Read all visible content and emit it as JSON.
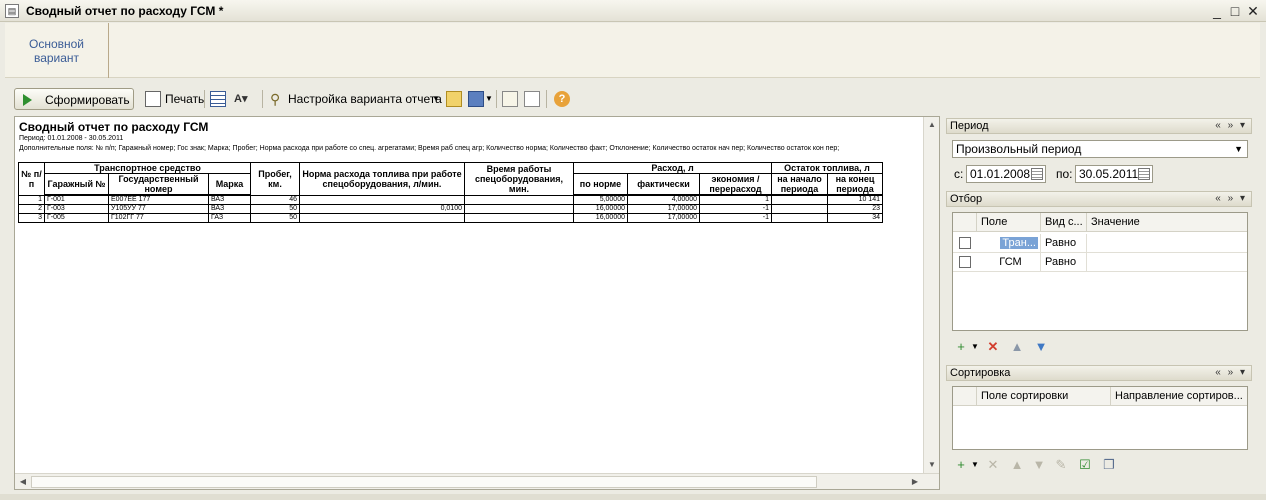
{
  "window": {
    "title": "Сводный отчет по расходу ГСМ *",
    "controls": [
      "_",
      "□",
      "✕"
    ]
  },
  "variant": {
    "label": "Основной вариант"
  },
  "toolbar": {
    "generate": "Сформировать",
    "print": "Печать",
    "settings": "Настройка варианта отчета"
  },
  "report": {
    "title": "Сводный отчет по расходу ГСМ",
    "period": "Период: 01.01.2008 - 30.05.2011",
    "extra": "Дополнительные поля: № п/п; Гаражный номер; Гос знак; Марка; Пробег; Норма расхода при работе со спец. агрегатами; Время раб спец агр; Количество норма; Количество факт; Отклонение; Количество остаток нач пер; Количество остаток кон пер;",
    "headers": {
      "num": "№ п/п",
      "transport": "Транспортное средство",
      "garage": "Гаражный №",
      "plate": "Государственный номер",
      "brand": "Марка",
      "mileage": "Пробег, км.",
      "norm": "Норма расхода топлива при работе спецоборудования, л/мин.",
      "worktime": "Время работы спецоборудования, мин.",
      "consumption": "Расход, л",
      "by_norm": "по норме",
      "actual": "фактически",
      "economy": "экономия / перерасход",
      "remainder": "Остаток топлива, л",
      "start": "на начало периода",
      "end": "на конец периода"
    },
    "rows": [
      {
        "n": "1",
        "garage": "Г-001",
        "plate": "Е007ЕЕ 177",
        "brand": "ВАЗ",
        "mileage": "46",
        "norm": "",
        "worktime": "",
        "by_norm": "5,00000",
        "actual": "4,00000",
        "economy": "1",
        "start": "",
        "end": "10 141"
      },
      {
        "n": "2",
        "garage": "Г-003",
        "plate": "У105УУ 77",
        "brand": "ВАЗ",
        "mileage": "50",
        "norm": "0,0100",
        "worktime": "",
        "by_norm": "16,00000",
        "actual": "17,00000",
        "economy": "-1",
        "start": "",
        "end": "23"
      },
      {
        "n": "3",
        "garage": "Г-005",
        "plate": "Г102ГГ 77",
        "brand": "ГАЗ",
        "mileage": "50",
        "norm": "",
        "worktime": "",
        "by_norm": "16,00000",
        "actual": "17,00000",
        "economy": "-1",
        "start": "",
        "end": "34"
      }
    ]
  },
  "period_panel": {
    "title": "Период",
    "type": "Произвольный период",
    "from_label": "с:",
    "from": "01.01.2008",
    "to_label": "по:",
    "to": "30.05.2011"
  },
  "filter_panel": {
    "title": "Отбор",
    "columns": [
      "Поле",
      "Вид с...",
      "Значение"
    ],
    "rows": [
      {
        "field": "Тран...",
        "kind": "Равно",
        "value": ""
      },
      {
        "field": "ГСМ",
        "kind": "Равно",
        "value": ""
      }
    ]
  },
  "sort_panel": {
    "title": "Сортировка",
    "columns": [
      "Поле сортировки",
      "Направление сортиров..."
    ]
  },
  "panel_controls": "« » ▾"
}
